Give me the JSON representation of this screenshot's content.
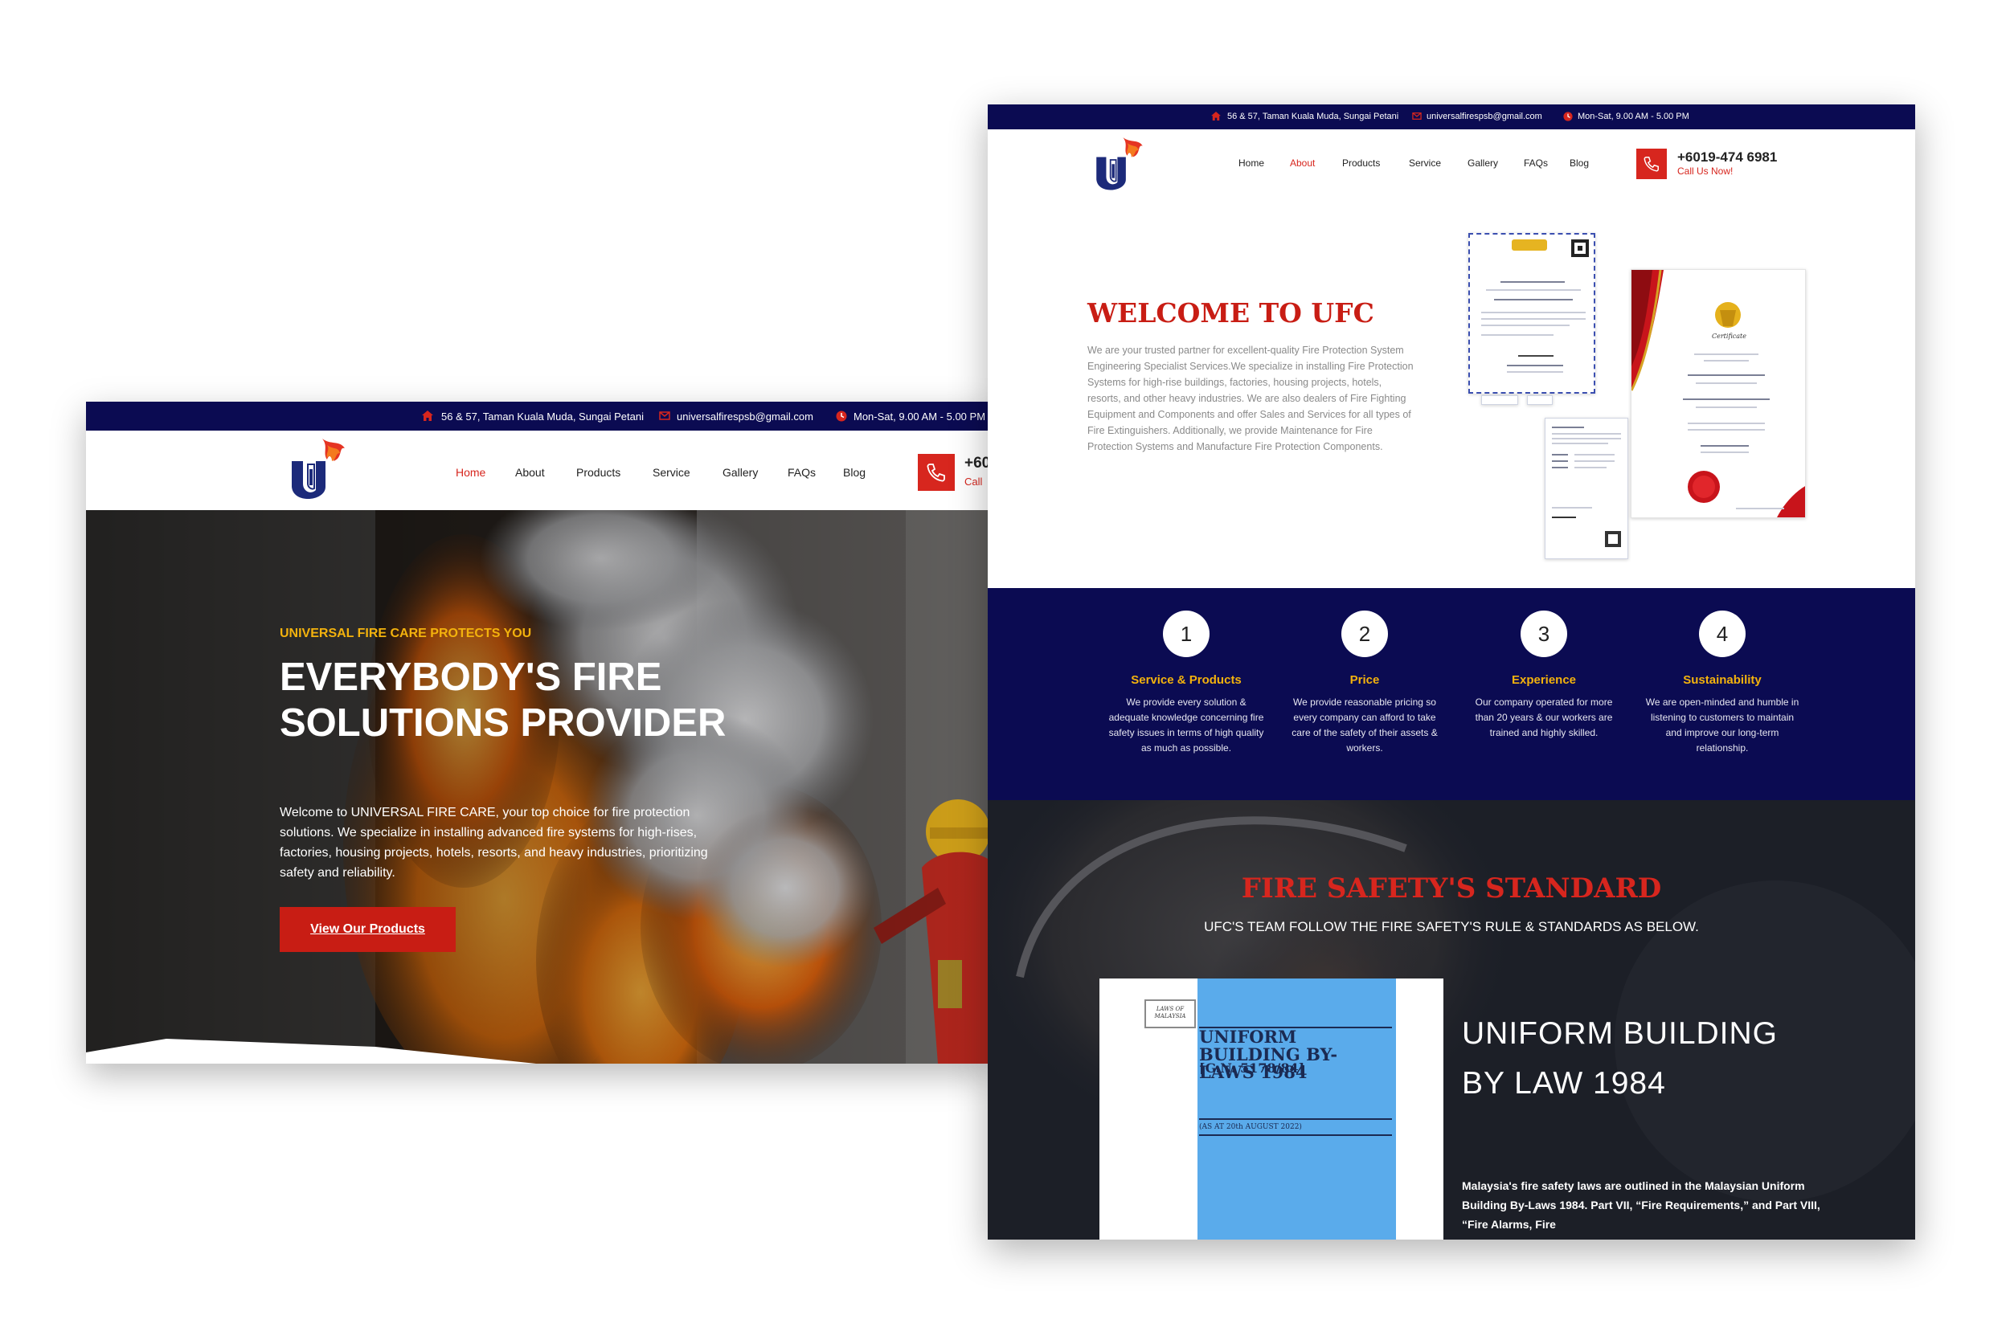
{
  "site": {
    "address": "56 & 57, Taman Kuala Muda, Sungai Petani",
    "email": "universalfirespsb@gmail.com",
    "hours": "Mon-Sat, 9.00 AM - 5.00 PM",
    "phone": "+6019-474 6981",
    "phone_left_partial": "+60",
    "call_label": "Call Us Now!",
    "call_label_partial": "Call",
    "nav": [
      "Home",
      "About",
      "Products",
      "Service",
      "Gallery",
      "FAQs",
      "Blog"
    ]
  },
  "left_page": {
    "active_nav": "Home",
    "hero": {
      "eyebrow": "UNIVERSAL FIRE CARE PROTECTS YOU",
      "heading": "EVERYBODY'S FIRE SOLUTIONS PROVIDER",
      "text": "Welcome to UNIVERSAL FIRE CARE, your top choice for fire protection solutions. We specialize in installing advanced fire systems for high-rises, factories, housing projects, hotels, resorts, and heavy industries, prioritizing safety and reliability.",
      "button": "View Our Products"
    }
  },
  "right_page": {
    "active_nav": "About",
    "welcome": {
      "title": "WELCOME TO UFC",
      "text": "We are your trusted partner for excellent-quality Fire Protection System Engineering Specialist Services.We specialize in installing Fire Protection Systems for high-rise buildings, factories, housing projects, hotels, resorts, and other heavy industries. We are also dealers of Fire Fighting Equipment and Components and offer Sales and Services for all types of Fire Extinguishers. Additionally, we provide Maintenance for Fire Protection Systems and Manufacture Fire Protection Components."
    },
    "features": [
      {
        "number": "1",
        "title": "Service & Products",
        "text": "We provide every solution & adequate knowledge concerning fire safety issues in terms of high quality as much as possible."
      },
      {
        "number": "2",
        "title": "Price",
        "text": "We provide reasonable pricing so every company can afford to take care of the safety of their assets & workers."
      },
      {
        "number": "3",
        "title": "Experience",
        "text": "Our company operated for more than 20 years & our workers are trained and highly skilled."
      },
      {
        "number": "4",
        "title": "Sustainability",
        "text": "We are open-minded and humble in listening to customers to maintain and improve our long-term relationship."
      }
    ],
    "standard": {
      "title": "FIRE SAFETY'S STANDARD",
      "subtitle": "UFC'S TEAM FOLLOW THE FIRE SAFETY'S RULE & STANDARDS AS BELOW.",
      "book": {
        "label": "LAWS OF MALAYSIA",
        "title": "UNIFORM BUILDING BY-LAWS 1984",
        "gn": "[G.N. 5178/84]",
        "date": "(AS AT 20th AUGUST 2022)"
      },
      "item_title": "UNIFORM BUILDING BY LAW 1984",
      "item_text": "Malaysia's fire safety laws are outlined in the Malaysian Uniform Building By-Laws 1984. Part VII, “Fire Requirements,” and Part VIII, “Fire Alarms, Fire"
    }
  },
  "icons": {
    "address": "home-icon",
    "email": "envelope-icon",
    "hours": "clock-icon",
    "phone": "phone-icon",
    "logo": "ufc-logo"
  },
  "colors": {
    "navy": "#0b0b52",
    "red": "#d7261e",
    "gold": "#f3b20d"
  }
}
